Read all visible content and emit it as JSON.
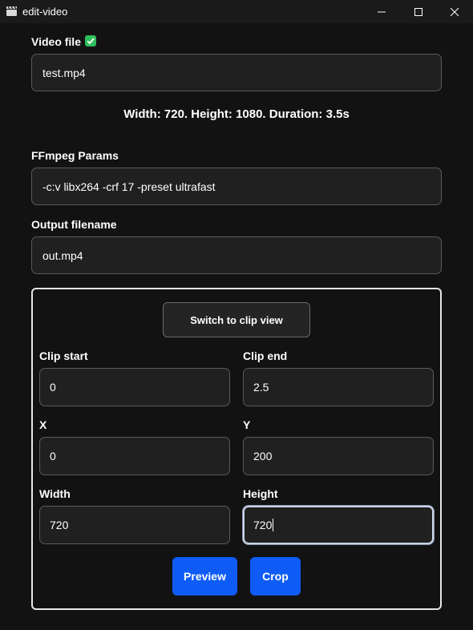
{
  "window": {
    "title": "edit-video"
  },
  "video_file": {
    "label": "Video file",
    "value": "test.mp4",
    "status_icon": "check-icon"
  },
  "video_info": "Width: 720. Height: 1080. Duration: 3.5s",
  "ffmpeg_params": {
    "label": "FFmpeg Params",
    "value": "-c:v libx264 -crf 17 -preset ultrafast"
  },
  "output_filename": {
    "label": "Output filename",
    "value": "out.mp4"
  },
  "panel": {
    "switch_label": "Switch to clip view",
    "clip_start": {
      "label": "Clip start",
      "value": "0"
    },
    "clip_end": {
      "label": "Clip end",
      "value": "2.5"
    },
    "x": {
      "label": "X",
      "value": "0"
    },
    "y": {
      "label": "Y",
      "value": "200"
    },
    "width": {
      "label": "Width",
      "value": "720"
    },
    "height": {
      "label": "Height",
      "value": "720"
    },
    "preview_label": "Preview",
    "crop_label": "Crop"
  },
  "colors": {
    "background": "#121212",
    "accent": "#0e5cf5",
    "success": "#2fbf5d"
  }
}
